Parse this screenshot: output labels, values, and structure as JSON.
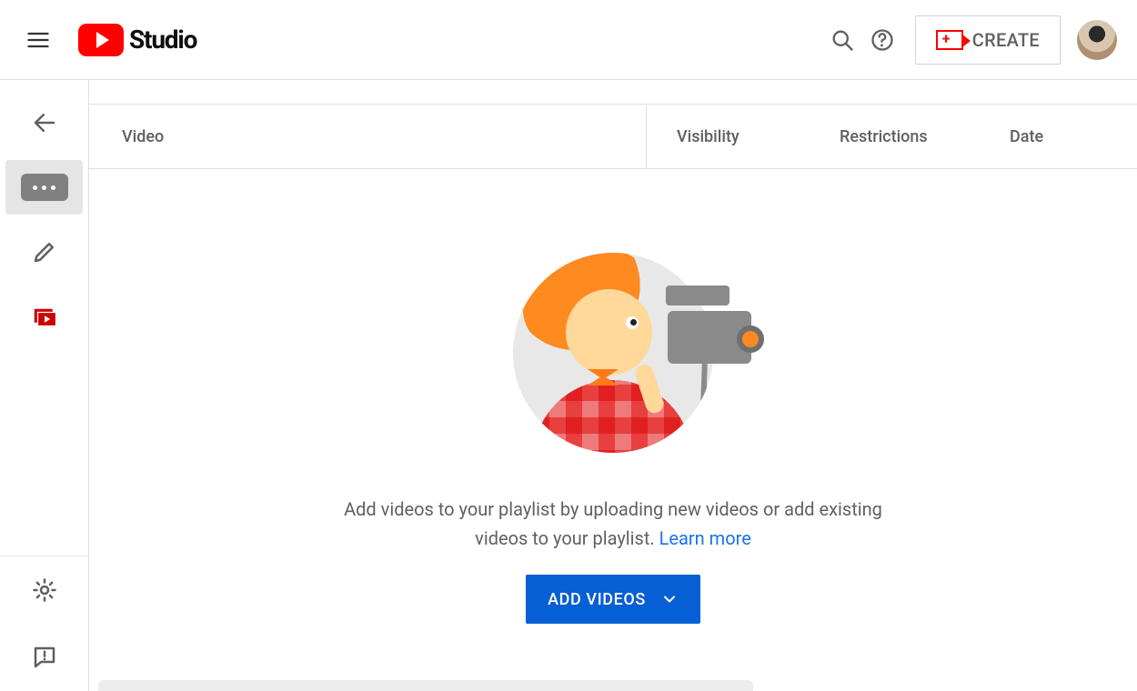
{
  "header": {
    "logo_text": "Studio",
    "create_label": "CREATE"
  },
  "columns": {
    "video": "Video",
    "visibility": "Visibility",
    "restrictions": "Restrictions",
    "date": "Date"
  },
  "empty_state": {
    "message": "Add videos to your playlist by uploading new videos or add existing videos to your playlist. ",
    "learn_more": "Learn more",
    "add_button": "ADD VIDEOS"
  },
  "sidebar": {
    "items": [
      {
        "name": "back"
      },
      {
        "name": "more",
        "selected": true
      },
      {
        "name": "edit-details"
      },
      {
        "name": "playlist-videos",
        "active": true
      }
    ],
    "footer": [
      {
        "name": "settings"
      },
      {
        "name": "feedback"
      }
    ]
  }
}
